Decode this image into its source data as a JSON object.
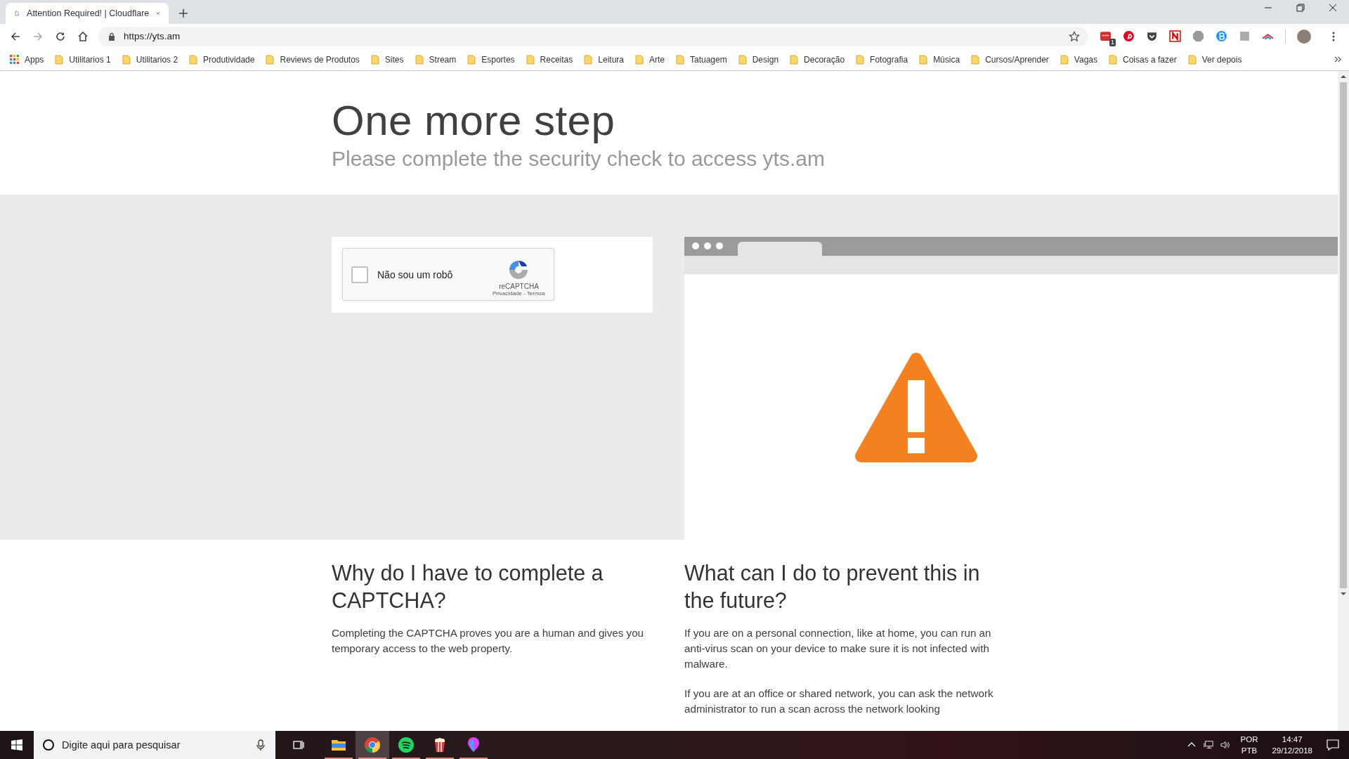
{
  "browser": {
    "tab": {
      "title": "Attention Required! | Cloudflare",
      "selected": true
    },
    "url": "https://yts.am",
    "apps_label": "Apps",
    "extension_badge": "1",
    "bookmarks": [
      "Utilitarios 1",
      "Utilitarios 2",
      "Produtividade",
      "Reviews de Produtos",
      "Sites",
      "Stream",
      "Esportes",
      "Receitas",
      "Leitura",
      "Arte",
      "Tatuagem",
      "Design",
      "Decoração",
      "Fotografia",
      "Música",
      "Cursos/Aprender",
      "Vagas",
      "Coisas a fazer",
      "Ver depois"
    ]
  },
  "page": {
    "title": "One more step",
    "subtitle": "Please complete the security check to access yts.am",
    "captcha": {
      "label": "Não sou um robô",
      "checked": false,
      "brand": "reCAPTCHA",
      "privacy": "Privacidade",
      "separator": "-",
      "terms": "Termos"
    },
    "sections": [
      {
        "heading": "Why do I have to complete a CAPTCHA?",
        "paragraphs": [
          "Completing the CAPTCHA proves you are a human and gives you temporary access to the web property."
        ]
      },
      {
        "heading": "What can I do to prevent this in the future?",
        "paragraphs": [
          "If you are on a personal connection, like at home, you can run an anti-virus scan on your device to make sure it is not infected with malware.",
          "If you are at an office or shared network, you can ask the network administrator to run a scan across the network looking"
        ]
      }
    ]
  },
  "taskbar": {
    "search_placeholder": "Digite aqui para pesquisar",
    "apps": [
      {
        "kind": "explorer",
        "selected": false
      },
      {
        "kind": "chrome",
        "selected": true
      },
      {
        "kind": "spotify",
        "selected": false
      },
      {
        "kind": "popcorn",
        "selected": false
      },
      {
        "kind": "paint",
        "selected": false
      }
    ],
    "language": "POR",
    "layout": "PTB",
    "time": "14:47",
    "date": "29/12/2018"
  }
}
